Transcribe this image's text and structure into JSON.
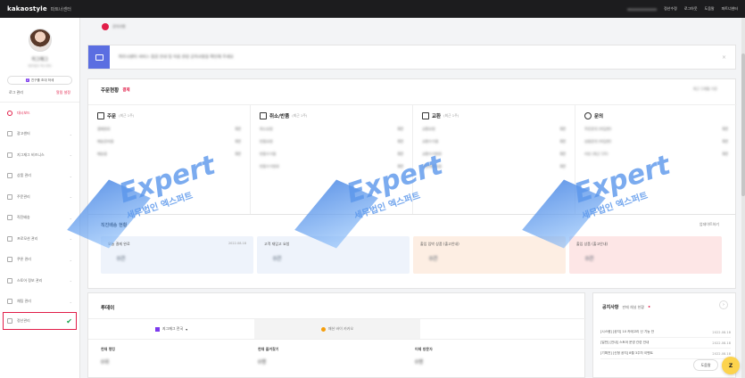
{
  "topbar": {
    "brand": "kakaostyle",
    "brand_sub": "파트너센터",
    "links": [
      "정산수정",
      "로그아웃",
      "도움말",
      "파트너센터"
    ]
  },
  "sidebar": {
    "user_name": "지그재그",
    "user_sub": "세무법인 엑스퍼트",
    "invite_label": "친구를 초대 하세",
    "invite_pill": "Z",
    "link_1": "로그 관리",
    "link_2": "알림 설정",
    "items": [
      {
        "label": "대시보드"
      },
      {
        "label": "광고센터"
      },
      {
        "label": "지그재그 비즈니스"
      },
      {
        "label": "상품 관리"
      },
      {
        "label": "주문관리"
      },
      {
        "label": "직진배송"
      },
      {
        "label": "프로모션 관리"
      },
      {
        "label": "쿠폰 관리"
      },
      {
        "label": "스토어 정보 관리"
      },
      {
        "label": "채팅 관리"
      },
      {
        "label": "정산관리"
      }
    ],
    "selected_check": "✔"
  },
  "main": {
    "notice_pin": "공지사항",
    "banner_text": "파트너센터 서비스 점검 안내 및 이용 관련 공지사항을 확인해 주세요",
    "order": {
      "title": "주문현황",
      "badge": "결제",
      "period": "최근 1개월 기준",
      "columns": [
        {
          "name": "주문",
          "note": "(최근 1주)",
          "rows": [
            [
              "결제완료",
              "0건"
            ],
            [
              "배송준비중",
              "0건"
            ],
            [
              "배송중",
              "0건"
            ]
          ]
        },
        {
          "name": "취소/반품",
          "note": "(최근 1주)",
          "rows": [
            [
              "취소요청",
              "0건"
            ],
            [
              "반품요청",
              "0건"
            ],
            [
              "반품수거중",
              "0건"
            ],
            [
              "반품수거완료",
              "0건"
            ]
          ]
        },
        {
          "name": "교환",
          "note": "(최근 1주)",
          "rows": [
            [
              "교환요청",
              "0건"
            ],
            [
              "교환수거중",
              "0건"
            ],
            [
              "교환수거완료",
              "0건"
            ],
            [
              "교환재배송중",
              "0건"
            ]
          ]
        },
        {
          "name": "문의",
          "note": "",
          "rows": [
            [
              "주문문의 (미답변)",
              "0건"
            ],
            [
              "상품문의 (미답변)",
              "0건"
            ],
            [
              "리뷰 (최근 1주)",
              "0건"
            ]
          ]
        }
      ]
    },
    "watermark": {
      "text": "Expert",
      "sub": "세무법인 엑스퍼트"
    },
    "delivery": {
      "title": "직진배송 현황",
      "update": "업데이트하기",
      "boxes": [
        {
          "label": "오늘 결제 완료",
          "value": "0건",
          "date": "2022.08.18"
        },
        {
          "label": "고객 재입고 요청",
          "value": "0건",
          "date": ""
        },
        {
          "label": "출입 입박 상품 (출고안내)",
          "value": "0건",
          "date": ""
        },
        {
          "label": "출입 상품 (출고안내)",
          "value": "0건",
          "date": ""
        }
      ]
    },
    "today": {
      "title": "투데이",
      "tab_1": "지그재그 전국",
      "tab_1_caret": "▾",
      "tab_2": "패션 바이 카카오",
      "stats": [
        {
          "label": "현재 랭킹",
          "value": "0위"
        },
        {
          "label": "현재 즐겨찾기",
          "value": "0명"
        },
        {
          "label": "어제 방문자",
          "value": "0명"
        }
      ]
    },
    "notices": {
      "title": "공지사항",
      "sub": "판매 채널 현황",
      "new_mark": "•",
      "arrow": "›",
      "items": [
        {
          "text": "[시스템] [공지] 10 카테고리 신 기능 안",
          "date": "2022.08.18"
        },
        {
          "text": "[일반] [안내] 스토어 운영 관련 안내",
          "date": "2022.08.18"
        },
        {
          "text": "[기획전] [신청 공지] 8월 3주차 이벤트",
          "date": "2022.08.18"
        }
      ]
    },
    "help_label": "도움말",
    "fab_label": "Z"
  }
}
